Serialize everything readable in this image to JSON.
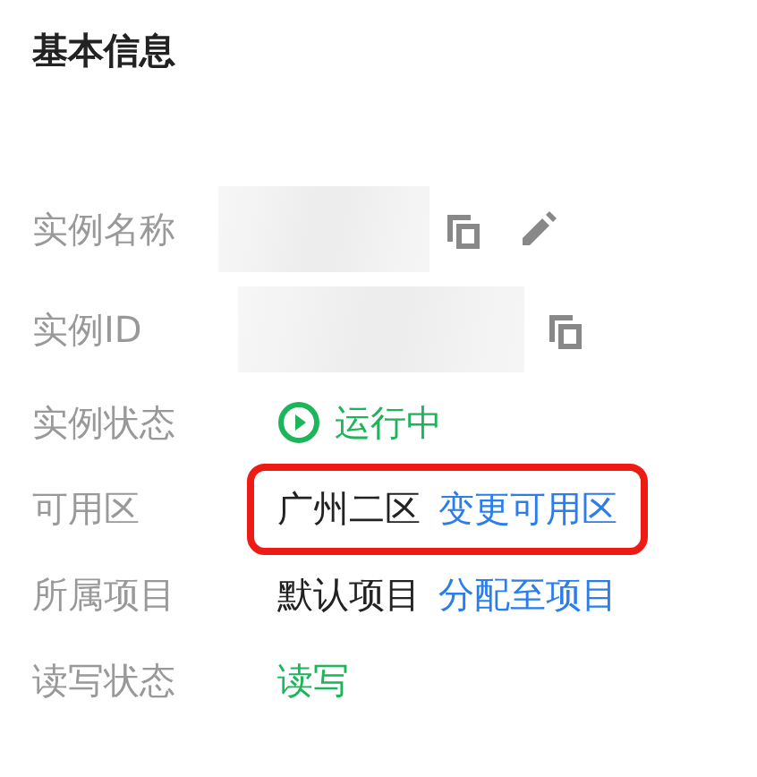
{
  "title": "基本信息",
  "fields": [
    {
      "kind": "redacted",
      "label": "实例名称",
      "copyable": true,
      "editable": true
    },
    {
      "kind": "redacted",
      "label": "实例ID",
      "copyable": true,
      "editable": false
    },
    {
      "kind": "status",
      "label": "实例状态",
      "value": "运行中"
    },
    {
      "kind": "text",
      "label": "可用区",
      "value": "广州二区",
      "link": "变更可用区",
      "highlighted": true
    },
    {
      "kind": "text",
      "label": "所属项目",
      "value": "默认项目",
      "link": "分配至项目",
      "highlighted": false
    },
    {
      "kind": "status_text",
      "label": "读写状态",
      "value": "读写"
    }
  ]
}
